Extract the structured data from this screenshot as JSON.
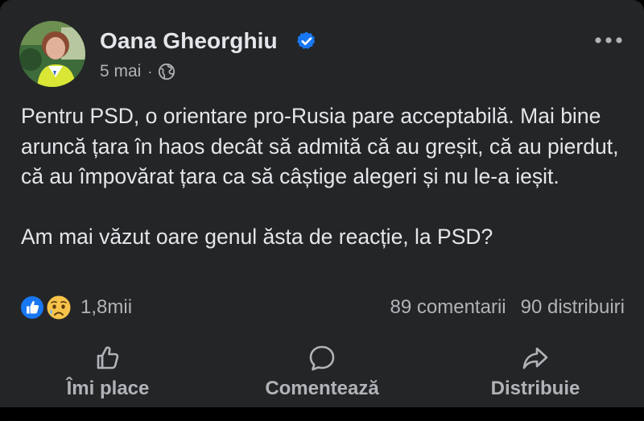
{
  "author": {
    "name": "Oana Gheorghiu",
    "verified": true,
    "verified_icon": "verified-badge-icon",
    "avatar_icon": "profile-photo"
  },
  "meta": {
    "date": "5 mai",
    "separator": "·",
    "audience_icon": "globe-icon"
  },
  "menu": {
    "icon": "more-options-icon"
  },
  "post": {
    "paragraph_1": "Pentru PSD, o orientare pro-Rusia pare acceptabilă. Mai bine aruncă țara în haos decât să admită că au greșit, că au pierdut, că au împovărat țara ca să câștige alegeri și nu le-a ieșit.",
    "paragraph_2": "Am mai văzut oare genul ăsta de reacție, la PSD?"
  },
  "stats": {
    "reactions_icons": [
      "like-reaction-icon",
      "sad-reaction-icon"
    ],
    "reactions_count": "1,8mii",
    "comments": "89 comentarii",
    "shares": "90 distribuiri"
  },
  "actions": {
    "like_label": "Îmi place",
    "comment_label": "Comentează",
    "share_label": "Distribuie"
  },
  "colors": {
    "background": "#242526",
    "text_primary": "#e4e6eb",
    "text_secondary": "#b0b3b8",
    "accent_blue": "#1877f2",
    "sad_yellow": "#f7c34a"
  }
}
